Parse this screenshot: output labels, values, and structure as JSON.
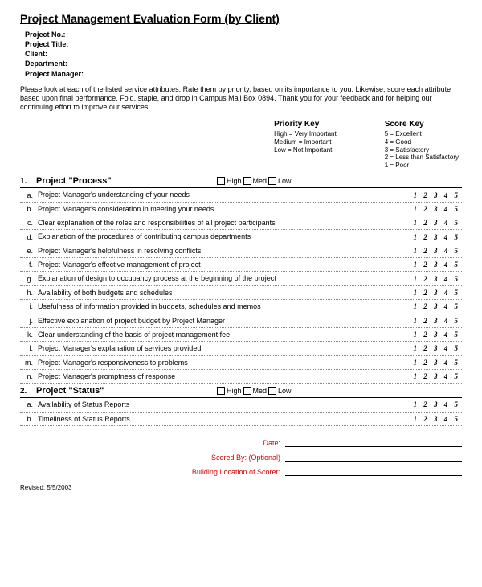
{
  "title": "Project Management Evaluation Form (by Client)",
  "header": {
    "project_no": "Project No.:",
    "project_title": "Project Title:",
    "client": "Client:",
    "department": "Department:",
    "project_manager": "Project Manager:"
  },
  "instructions": "Please look at each of the listed service attributes. Rate them by priority, based on its importance to you. Likewise, score each attribute based upon final performance. Fold, staple, and drop in Campus Mail Box 0894. Thank you for your feedback and for helping our continuing effort to improve our services.",
  "priority_key": {
    "title": "Priority Key",
    "l1": "High = Very Important",
    "l2": "Medium = Important",
    "l3": "Low = Not Important"
  },
  "score_key": {
    "title": "Score Key",
    "l1": "5 = Excellent",
    "l2": "4 = Good",
    "l3": "3 = Satisfactory",
    "l4": "2 = Less than Satisfactory",
    "l5": "1 = Poor"
  },
  "checks": {
    "high": "High",
    "med": "Med",
    "low": "Low"
  },
  "score_scale": "1 2 3 4 5",
  "sections": {
    "s1": {
      "num": "1.",
      "title": "Project \"Process\""
    },
    "s2": {
      "num": "2.",
      "title": "Project \"Status\""
    }
  },
  "s1_items": {
    "a": {
      "l": "a.",
      "t": "Project Manager's understanding of your needs"
    },
    "b": {
      "l": "b.",
      "t": "Project Manager's consideration in meeting your needs"
    },
    "c": {
      "l": "c.",
      "t": "Clear explanation of the roles and responsibilities of all project participants"
    },
    "d": {
      "l": "d.",
      "t": "Explanation of the procedures of contributing campus departments"
    },
    "e": {
      "l": "e.",
      "t": "Project Manager's helpfulness in resolving conflicts"
    },
    "f": {
      "l": "f.",
      "t": "Project Manager's effective management of project"
    },
    "g": {
      "l": "g.",
      "t": "Explanation of design to occupancy process at the beginning of the project"
    },
    "h": {
      "l": "h.",
      "t": "Availability of both budgets and schedules"
    },
    "i": {
      "l": "i.",
      "t": "Usefulness of information provided in budgets, schedules and memos"
    },
    "j": {
      "l": "j.",
      "t": "Effective explanation of project budget by Project Manager"
    },
    "k": {
      "l": "k.",
      "t": "Clear understanding of the basis of project management fee"
    },
    "l": {
      "l": "l.",
      "t": "Project Manager's explanation of services provided"
    },
    "m": {
      "l": "m.",
      "t": "Project Manager's responsiveness to problems"
    },
    "n": {
      "l": "n.",
      "t": "Project Manager's promptness of response"
    }
  },
  "s2_items": {
    "a": {
      "l": "a.",
      "t": "Availability of Status Reports"
    },
    "b": {
      "l": "b.",
      "t": "Timeliness of Status Reports"
    }
  },
  "sig": {
    "date": "Date:",
    "scored_by": "Scored By:  (Optional)",
    "location": "Building Location of Scorer:"
  },
  "revised": "Revised: 5/5/2003"
}
